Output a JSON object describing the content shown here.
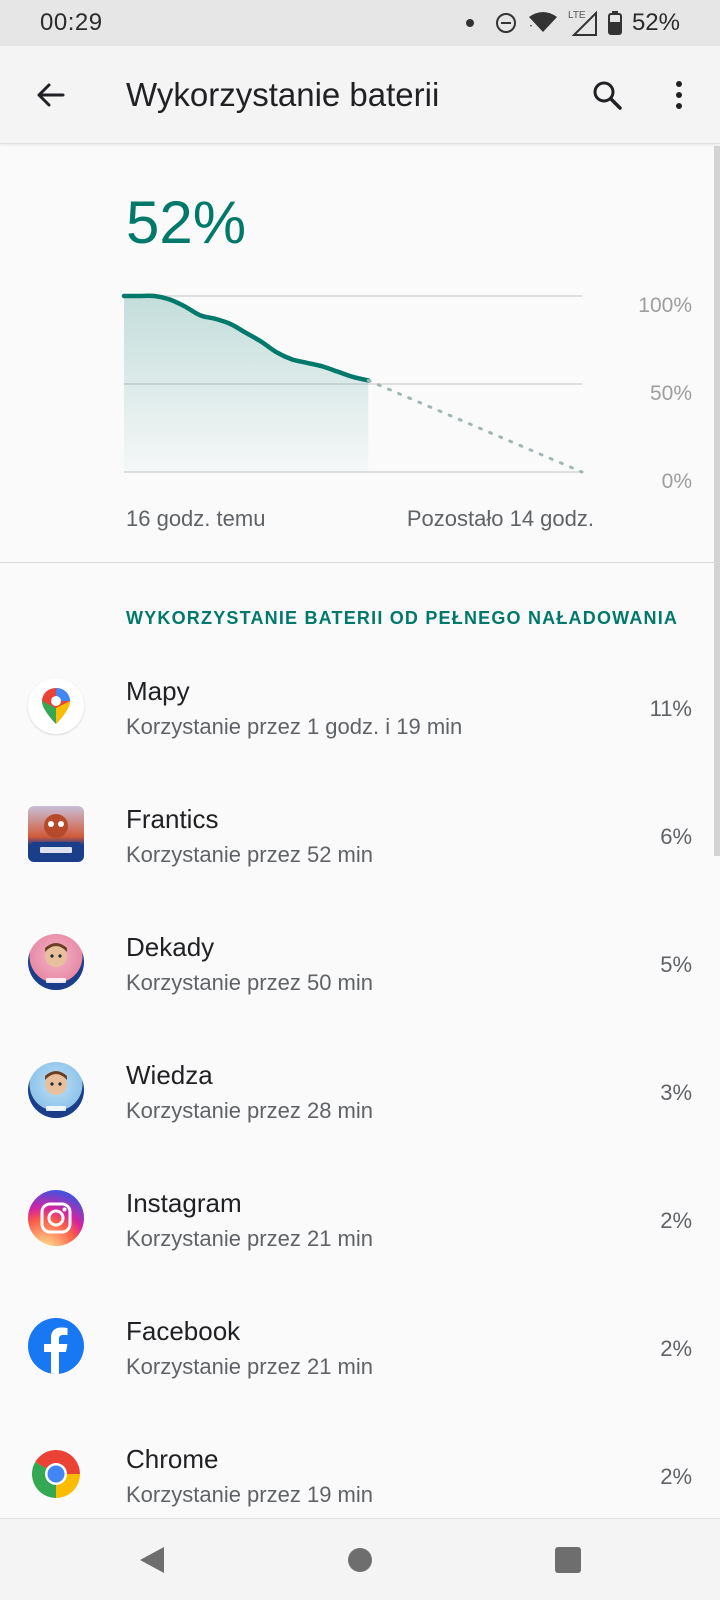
{
  "status_bar": {
    "time": "00:29",
    "network": "LTE",
    "battery": "52%"
  },
  "app_bar": {
    "title": "Wykorzystanie baterii"
  },
  "battery": {
    "level": "52%",
    "time_since": "16 godz. temu",
    "time_remaining": "Pozostało 14 godz."
  },
  "chart_data": {
    "type": "area",
    "ylabel": "",
    "xlabel": "",
    "ylim": [
      0,
      100
    ],
    "y_ticks": [
      "100%",
      "50%",
      "0%"
    ],
    "x_labels": [
      "16 godz. temu",
      "Pozostało 14 godz."
    ],
    "series": [
      {
        "x": [
          0,
          1,
          2,
          3,
          4,
          5,
          6,
          7,
          8,
          9,
          10,
          11,
          12,
          13,
          14,
          15,
          16
        ],
        "values": [
          100,
          100,
          100,
          98,
          94,
          89,
          87,
          84,
          79,
          74,
          68,
          64,
          62,
          60,
          57,
          54,
          52
        ]
      },
      {
        "projected": true,
        "x": [
          16,
          30
        ],
        "values": [
          52,
          0
        ]
      }
    ],
    "accent": "#00796b"
  },
  "section": {
    "title": "WYKORZYSTANIE BATERII OD PEŁNEGO NAŁADOWANIA"
  },
  "apps": [
    {
      "name": "Mapy",
      "usage": "Korzystanie przez 1 godz. i 19 min",
      "percent": "11%",
      "icon": "google-maps-icon"
    },
    {
      "name": "Frantics",
      "usage": "Korzystanie przez 52 min",
      "percent": "6%",
      "icon": "frantics-icon"
    },
    {
      "name": "Dekady",
      "usage": "Korzystanie przez 50 min",
      "percent": "5%",
      "icon": "dekady-icon"
    },
    {
      "name": "Wiedza",
      "usage": "Korzystanie przez 28 min",
      "percent": "3%",
      "icon": "wiedza-icon"
    },
    {
      "name": "Instagram",
      "usage": "Korzystanie przez 21 min",
      "percent": "2%",
      "icon": "instagram-icon"
    },
    {
      "name": "Facebook",
      "usage": "Korzystanie przez 21 min",
      "percent": "2%",
      "icon": "facebook-icon"
    },
    {
      "name": "Chrome",
      "usage": "Korzystanie przez 19 min",
      "percent": "2%",
      "icon": "chrome-icon"
    }
  ]
}
